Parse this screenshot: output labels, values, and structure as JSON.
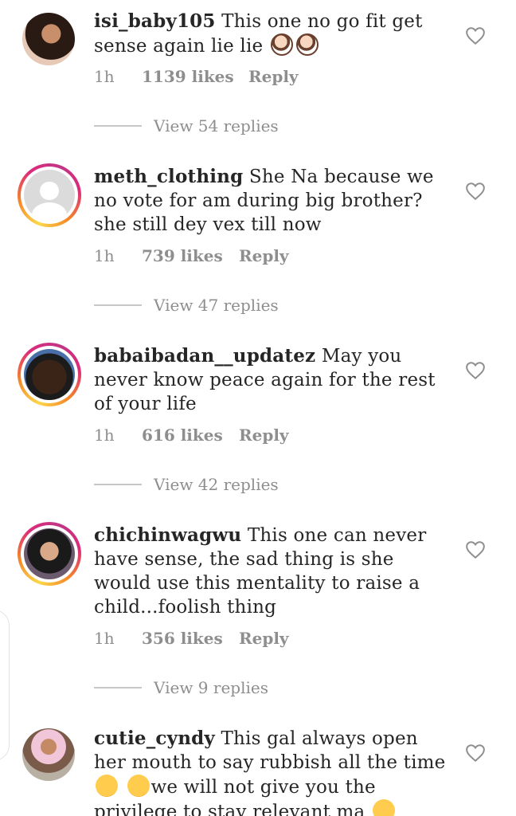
{
  "comments": [
    {
      "username": "isi_baby105",
      "text": "This one no go fit get sense again lie lie",
      "emoji_after": [
        "woman-facepalming",
        "woman-facepalming"
      ],
      "time": "1h",
      "likes": "1139 likes",
      "reply": "Reply",
      "view_replies": "View 54 replies",
      "avatar": "photo-woman"
    },
    {
      "username": "meth_clothing",
      "text": "She Na because we no vote for am during big brother? she still dey vex till now",
      "time": "1h",
      "likes": "739 likes",
      "reply": "Reply",
      "view_replies": "View 47 replies",
      "avatar": "default-user"
    },
    {
      "username": "babaibadan__updatez",
      "text": "May you never know peace again for the rest of your life",
      "time": "1h",
      "likes": "616 likes",
      "reply": "Reply",
      "view_replies": "View 42 replies",
      "avatar": "photo-man"
    },
    {
      "username": "chichinwagwu",
      "text": "This one can never have sense, the sad thing is she would use this mentality to raise a child...foolish thing",
      "time": "1h",
      "likes": "356 likes",
      "reply": "Reply",
      "view_replies": "View 9 replies",
      "avatar": "photo-woman-2"
    },
    {
      "username": "cutie_cyndy",
      "text_part1": "This gal always open her mouth to say rubbish all the time",
      "text_part2": "we will not give you the privilege to stay relevant ma",
      "emoji": [
        "weary-face",
        "weary-face",
        "smirking-face"
      ],
      "avatar": "photo-woman-3"
    }
  ],
  "colors": {
    "text": "#262626",
    "meta": "#8e8e8e",
    "ring": [
      "#fdd74a",
      "#f58529",
      "#dd2a7b",
      "#c13584"
    ]
  }
}
